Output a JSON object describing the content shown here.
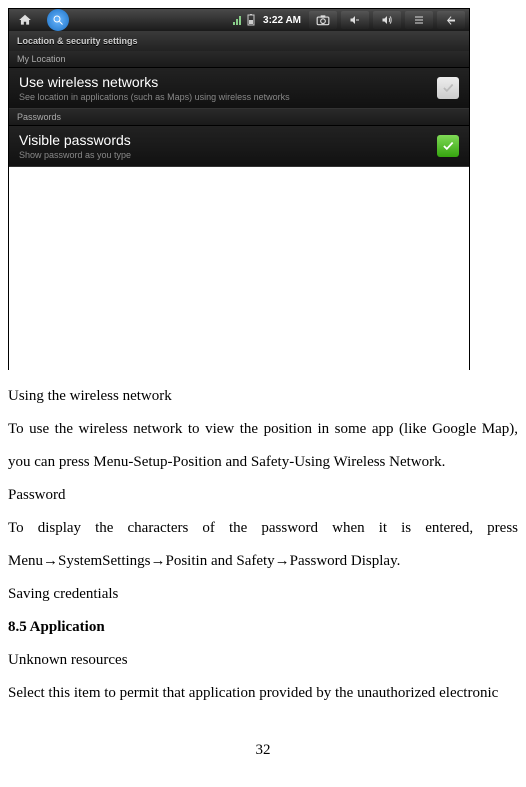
{
  "statusbar": {
    "time": "3:22 AM"
  },
  "settings": {
    "screen_title": "Location & security settings",
    "section_location": "My Location",
    "section_passwords": "Passwords",
    "wireless": {
      "title": "Use wireless networks",
      "sub": "See location in applications (such as Maps) using wireless networks"
    },
    "visible_pw": {
      "title": "Visible passwords",
      "sub": "Show password as you type"
    }
  },
  "doc": {
    "p1": "Using the wireless network",
    "p2": "To use the wireless network to view the position in some app (like Google Map), you can press Menu-Setup-Position and Safety-Using Wireless Network.",
    "p3": "Password",
    "p4": "To display the characters of the password when it is entered, press Menu→SystemSettings→Positin and Safety→Password Display.",
    "p5": "Saving credentials",
    "h": "8.5 Application",
    "p6": "Unknown resources",
    "p7": "Select this item to permit that application provided by the unauthorized electronic",
    "page": "32"
  }
}
